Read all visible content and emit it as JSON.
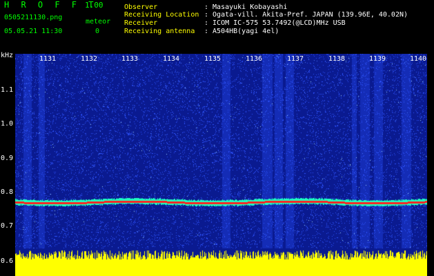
{
  "app": {
    "title": "H R O F F T",
    "version": "1.00"
  },
  "file": {
    "name": "0505211130.png",
    "datetime": "05.05.21 11:30"
  },
  "meteor": {
    "label": "meteor",
    "count": "0"
  },
  "header": {
    "rows": [
      {
        "label": "Observer",
        "value": ": Masayuki Kobayashi"
      },
      {
        "label": "Receiving Location",
        "value": ": Ogata-vill. Akita-Pref. JAPAN (139.96E, 40.02N)"
      },
      {
        "label": "Receiver",
        "value": ": ICOM IC-575 53.7492(@LCD)MHz USB"
      },
      {
        "label": "Receiving antenna",
        "value": ": A504HB(yagi 4el)"
      }
    ]
  },
  "spectrogram": {
    "y_unit": "kHz",
    "y_ticks": [
      "1.1",
      "1.0",
      "0.9",
      "0.8",
      "0.7",
      "0.6"
    ],
    "x_ticks": [
      "1131",
      "1132",
      "1133",
      "1134",
      "1135",
      "1136",
      "1137",
      "1138",
      "1139",
      "1140"
    ],
    "colors": {
      "background": "#0a1a90",
      "noise": "#2f54ff",
      "carrier": "#ff2020",
      "carrier_halo": "#20ffc0",
      "level_bar": "#ffff00"
    }
  }
}
